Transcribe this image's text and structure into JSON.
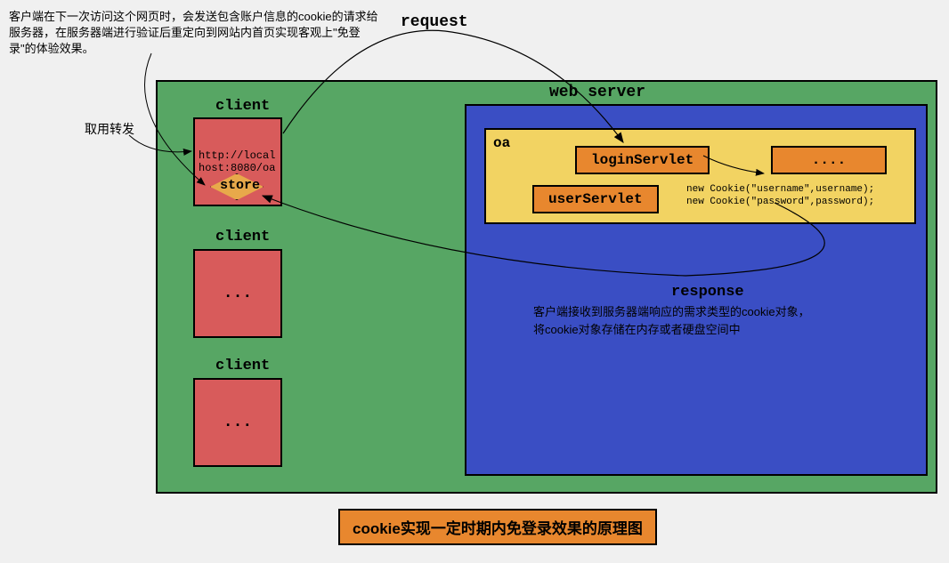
{
  "annotation_top": "客户端在下一次访问这个网页时，会发送包含账户信息的cookie的请求给服务器，在服务器端进行验证后重定向到网站内首页实现客观上\"免登录\"的体验效果。",
  "request_label": "request",
  "forward_label": "取用转发",
  "client": {
    "label1": "client",
    "url_line1": "http://local",
    "url_line2": "host:8080/oa",
    "store": "store",
    "label2": "client",
    "dots2": "...",
    "label3": "client",
    "dots3": "..."
  },
  "server": {
    "label": "web server",
    "oa_label": "oa",
    "login_servlet": "loginServlet",
    "dots_servlet": "....",
    "user_servlet": "userServlet",
    "cookie_code_line1": "new Cookie(\"username\",username);",
    "cookie_code_line2": "new Cookie(\"password\",password);",
    "response_label": "response",
    "response_desc_line1": "客户端接收到服务器端响应的需求类型的cookie对象，",
    "response_desc_line2": "将cookie对象存储在内存或者硬盘空间中"
  },
  "title": "cookie实现一定时期内免登录效果的原理图"
}
